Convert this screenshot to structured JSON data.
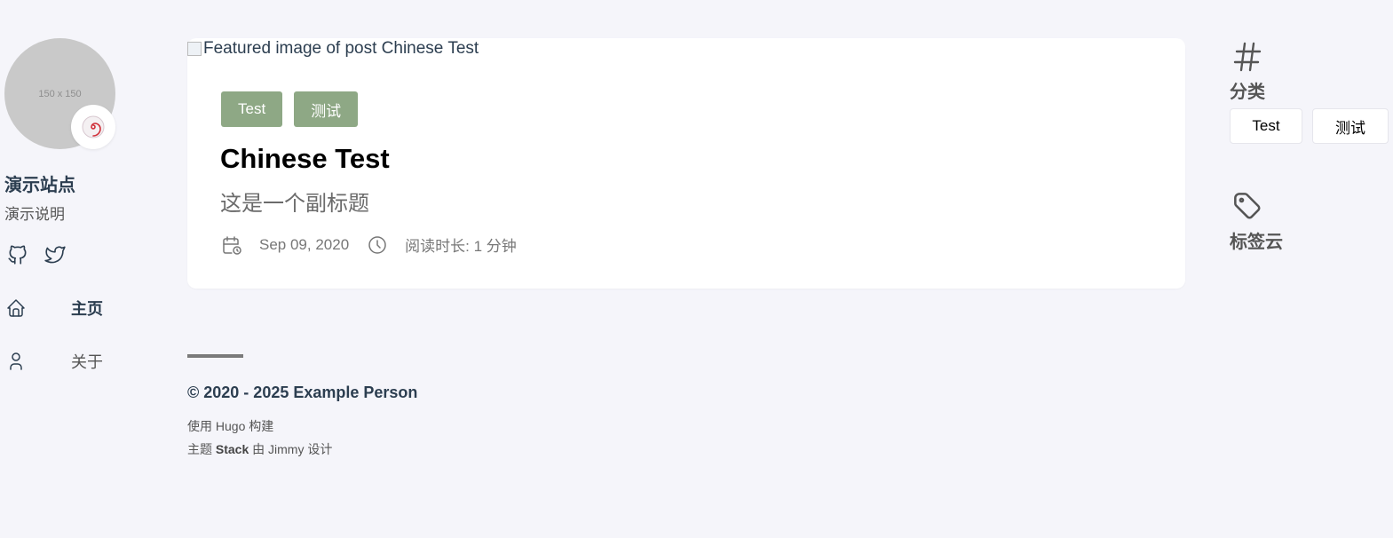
{
  "sidebar": {
    "avatar_placeholder": "150 x 150",
    "site_name": "演示站点",
    "site_description": "演示说明",
    "social": [
      {
        "icon": "github-icon"
      },
      {
        "icon": "twitter-icon"
      }
    ],
    "menu": [
      {
        "label": "主页",
        "icon": "home-icon",
        "active": true
      },
      {
        "label": "关于",
        "icon": "user-icon",
        "active": false
      }
    ]
  },
  "article": {
    "featured_image_alt": "Featured image of post Chinese Test",
    "categories": [
      "Test",
      "测试"
    ],
    "title": "Chinese Test",
    "subtitle": "这是一个副标题",
    "date": "Sep 09, 2020",
    "reading_time": "阅读时长: 1 分钟"
  },
  "footer": {
    "copyright": "© 2020 - 2025 Example Person",
    "built_with": "使用 Hugo 构建",
    "theme_prefix": "主题 ",
    "theme_name": "Stack",
    "theme_suffix": " 由 Jimmy 设计"
  },
  "widgets": {
    "categories_title": "分类",
    "categories": [
      "Test",
      "测试"
    ],
    "tagcloud_title": "标签云"
  },
  "colors": {
    "background": "#f5f5fa",
    "tag_background": "#8ea885",
    "text_dark": "#2c3e50"
  }
}
